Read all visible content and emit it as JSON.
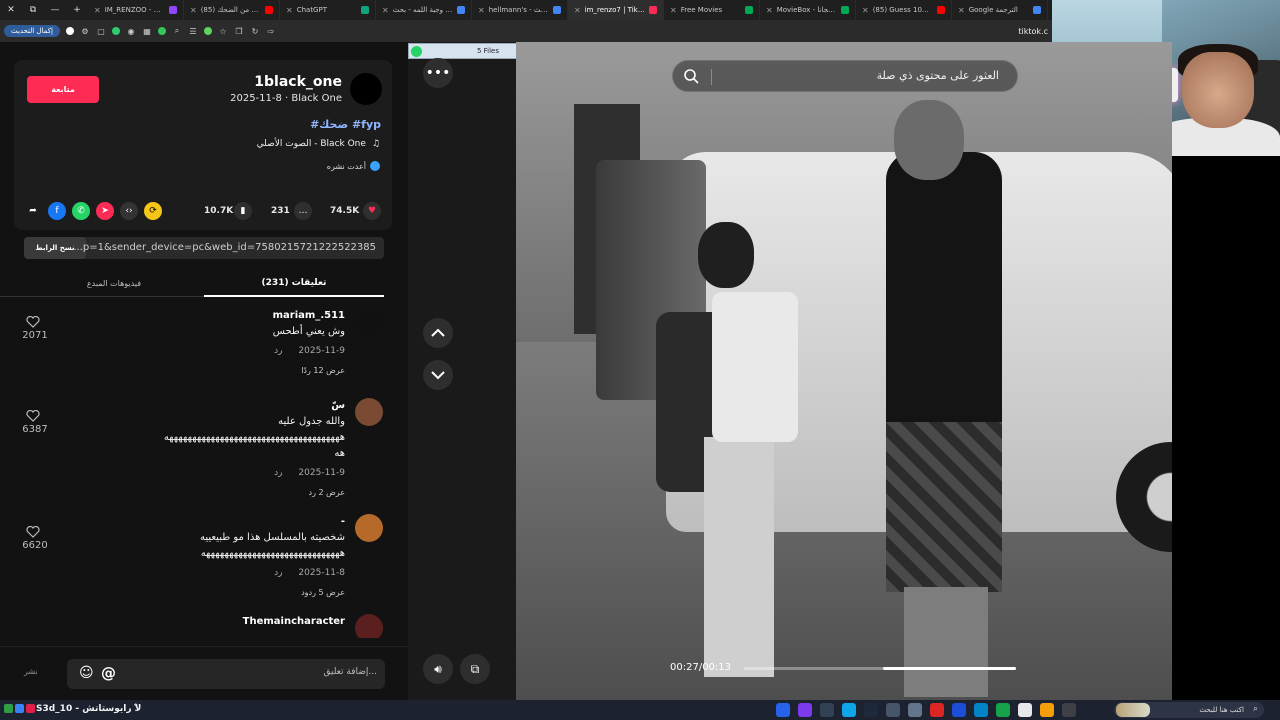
{
  "browser": {
    "tabs": [
      {
        "label": "IM_RENZOO - Watch",
        "color": "#9146ff",
        "active": false
      },
      {
        "label": "(85) ساعة من الضحك",
        "color": "#ff0000",
        "active": false
      },
      {
        "label": "ChatGPT",
        "color": "#10a37f",
        "active": false
      },
      {
        "label": "كتاكي وجبة اللمه - بحث",
        "color": "#4285f4",
        "active": false
      },
      {
        "label": "hellmann's - بحث Goog",
        "color": "#4285f4",
        "active": false
      },
      {
        "label": "im_renzo7 | TikTok",
        "color": "#fe2c55",
        "active": true
      },
      {
        "label": "Free Movies",
        "color": "#0a5",
        "active": false
      },
      {
        "label": "MovieBox - مسلسلات مجانا",
        "color": "#0a5",
        "active": false
      },
      {
        "label": "(85) Guess 101 Movies",
        "color": "#ff0000",
        "active": false
      },
      {
        "label": "Google الترجمة",
        "color": "#4285f4",
        "active": false
      }
    ],
    "update_label": "إكمال التحديث",
    "site": "tiktok.c"
  },
  "post": {
    "follow_label": "متابعة",
    "author_name": "1black_one",
    "author_sub": "2025-11-8 · Black One",
    "hashtags": "#ضحك #fyp",
    "music": "الصوت الأصلي - Black One",
    "repost": "أعدت نشره",
    "likes": "74.5K",
    "comments_count": "231",
    "saves": "10.7K",
    "link": "...p=1&sender_device=pc&web_id=7580215721222522385",
    "copy_label": "نسخ الرابط",
    "tab_comments": "تعليقات (231)",
    "tab_creator": "فيديوهات المبدع"
  },
  "comments": [
    {
      "name": "mariam_.511",
      "lines": [
        "وش يعني أطحس"
      ],
      "date": "2025-11-9",
      "reply": "رد",
      "replies": "عرض 12 ردًا",
      "likes": "2071"
    },
    {
      "name": "سّ",
      "lines": [
        "والله جدول عليه",
        "ههههههههههههههههههههههههههههههههههههههه",
        "هه"
      ],
      "date": "2025-11-9",
      "reply": "رد",
      "replies": "عرض 2 رد",
      "likes": "6387"
    },
    {
      "name": "-",
      "lines": [
        "شخصيته بالمسلسل هذا مو طبيعييه",
        "ههههههههههههههههههههههههههههههه"
      ],
      "date": "2025-11-8",
      "reply": "رد",
      "replies": "عرض 5 ردود",
      "likes": "6620"
    },
    {
      "name": "Themaincharacter",
      "lines": [],
      "date": "",
      "reply": "",
      "replies": "",
      "likes": ""
    }
  ],
  "input": {
    "post_label": "نشر",
    "placeholder": "إضافة تعليق..."
  },
  "files_chip": "5 Files",
  "video": {
    "search_placeholder": "العثور على محتوى ذي صلة",
    "time": "00:27/00:13",
    "progress": 0.49
  },
  "taskbar": {
    "title": "S3d_10 - لا رايوستاتش",
    "search_placeholder": "اكتب هنا للبحث"
  },
  "colors": {
    "accent": "#fe2c55",
    "hashtag": "#8fb6ff"
  }
}
